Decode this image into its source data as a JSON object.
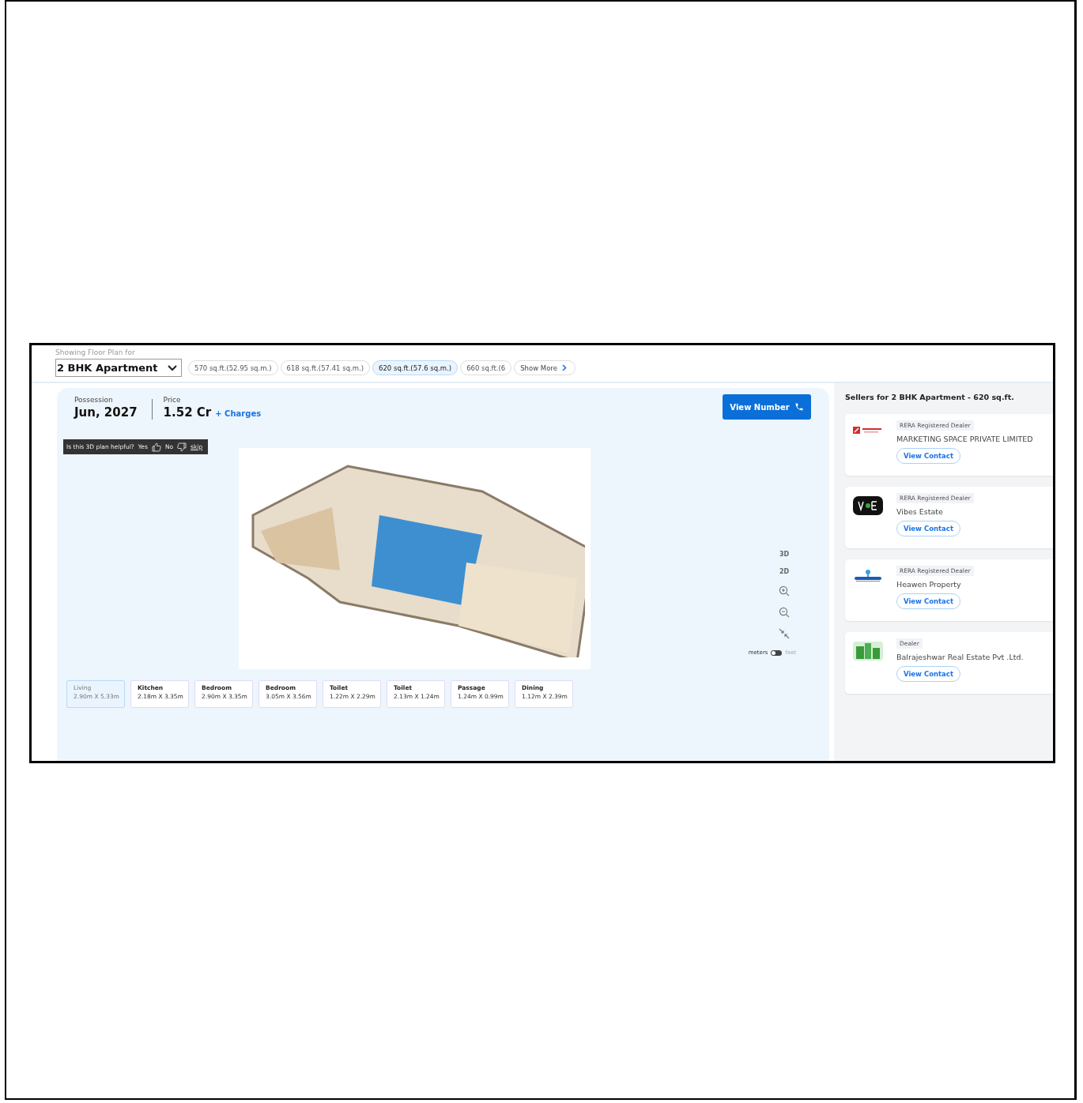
{
  "header": {
    "caption": "Showing Floor Plan for",
    "config": "2 BHK Apartment",
    "sizes": [
      {
        "label": "570 sq.ft.(52.95 sq.m.)",
        "selected": false
      },
      {
        "label": "618 sq.ft.(57.41 sq.m.)",
        "selected": false
      },
      {
        "label": "620 sq.ft.(57.6 sq.m.)",
        "selected": true
      },
      {
        "label": "660 sq.ft.(6",
        "selected": false
      }
    ],
    "show_more": "Show More"
  },
  "summary": {
    "possession_label": "Possession",
    "possession": "Jun, 2027",
    "price_label": "Price",
    "price": "1.52 Cr",
    "charges": "+ Charges",
    "cta": "View Number"
  },
  "feedback": {
    "question": "Is this 3D plan helpful?",
    "yes": "Yes",
    "no": "No",
    "skip": "skip"
  },
  "viewer_controls": {
    "modes": [
      "3D",
      "2D"
    ],
    "unit_left": "meters",
    "unit_right": "feet",
    "unit_on_right": false
  },
  "rooms": [
    {
      "name": "Living",
      "size": "2.90m X 5.33m",
      "selected": true
    },
    {
      "name": "Kitchen",
      "size": "2.18m X 3.35m",
      "selected": false
    },
    {
      "name": "Bedroom",
      "size": "2.90m X 3.35m",
      "selected": false
    },
    {
      "name": "Bedroom",
      "size": "3.05m X 3.56m",
      "selected": false
    },
    {
      "name": "Toilet",
      "size": "1.22m X 2.29m",
      "selected": false
    },
    {
      "name": "Toilet",
      "size": "2.13m X 1.24m",
      "selected": false
    },
    {
      "name": "Passage",
      "size": "1.24m X 0.99m",
      "selected": false
    },
    {
      "name": "Dining",
      "size": "1.12m X 2.39m",
      "selected": false
    }
  ],
  "sellers": {
    "title": "Sellers for 2 BHK Apartment - 620 sq.ft.",
    "items": [
      {
        "badge": "RERA Registered Dealer",
        "name": "MARKETING SPACE PRIVATE LIMITED",
        "action": "View Contact",
        "kind": "marketing"
      },
      {
        "badge": "RERA Registered Dealer",
        "name": "Vibes Estate",
        "action": "View Contact",
        "kind": "vibes"
      },
      {
        "badge": "RERA Registered Dealer",
        "name": "Heawen Property",
        "action": "View Contact",
        "kind": "heawen"
      },
      {
        "badge": "Dealer",
        "name": "Balrajeshwar Real Estate Pvt .Ltd.",
        "action": "View Contact",
        "kind": "building"
      }
    ]
  }
}
